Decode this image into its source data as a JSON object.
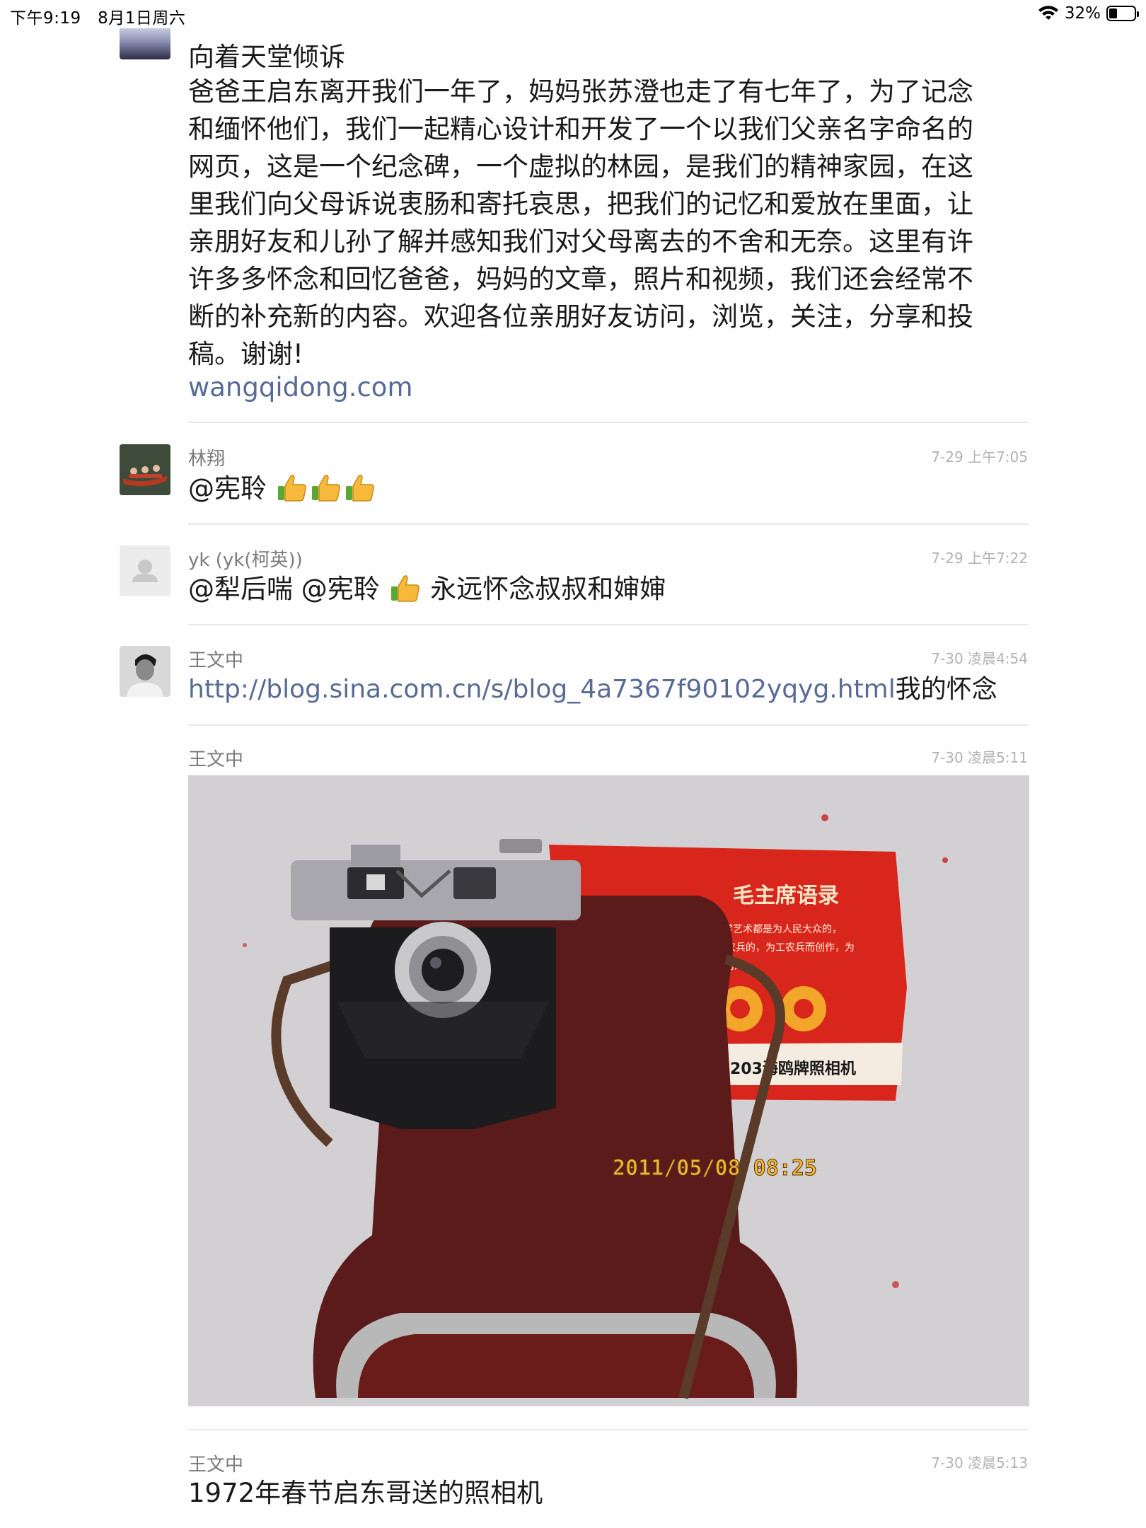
{
  "status_bar": {
    "time": "下午9:19",
    "date": "8月1日周六",
    "battery": "32%",
    "battery_level": 0.32
  },
  "post": {
    "title": "向着天堂倾诉",
    "body_lines": [
      "爸爸王启东离开我们一年了，妈妈张苏澄也走了有七年了，为了记念",
      "和缅怀他们，我们一起精心设计和开发了一个以我们父亲名字命名的",
      "网页，这是一个纪念碑，一个虚拟的林园，是我们的精神家园，在这",
      "里我们向父母诉说衷肠和寄托哀思，把我们的记忆和爱放在里面，让",
      "亲朋好友和儿孙了解并感知我们对父母离去的不舍和无奈。这里有许",
      "许多多怀念和回忆爸爸，妈妈的文章，照片和视频，我们还会经常不",
      "断的补充新的内容。欢迎各位亲朋好友访问，浏览，关注，分享和投",
      "稿。谢谢!"
    ],
    "link": "wangqidong.com"
  },
  "comments": [
    {
      "name": "林翔",
      "time": "7-29 上午7:05",
      "text": "@宪聆",
      "thumbs": 3
    },
    {
      "name": "yk (yk(柯英))",
      "time": "7-29 上午7:22",
      "text_before": "@犁后喘 @宪聆",
      "text_after": "永远怀念叔叔和婶婶"
    },
    {
      "name": "王文中",
      "time": "7-30 凌晨4:54",
      "link": "http://blog.sina.com.cn/s/blog_4a7367f90102yqyg.html",
      "text": "我的怀念"
    },
    {
      "name": "王文中",
      "time": "7-30 凌晨5:11"
    },
    {
      "name": "王文中",
      "time": "7-30 凌晨5:13",
      "text": "1972年春节启东哥送的照相机"
    }
  ],
  "photo": {
    "card_title": "毛主席语录",
    "card_quote": [
      "我们的文学艺术都是为人民大众的，",
      "首先是为工农兵的，为工农兵而创作，为",
      "工农兵所利用的。"
    ],
    "card_footer": "203海鸥牌照相机",
    "date_stamp": "2011/05/08 08:25"
  }
}
